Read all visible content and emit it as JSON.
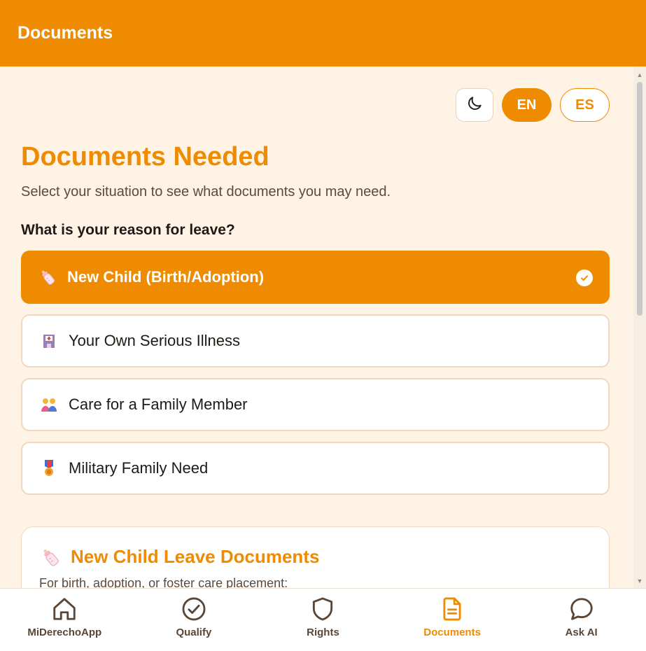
{
  "header": {
    "title": "Documents"
  },
  "toggles": {
    "theme_icon": "moon-icon",
    "lang_en": "EN",
    "lang_es": "ES"
  },
  "page": {
    "title": "Documents Needed",
    "subtitle": "Select your situation to see what documents you may need.",
    "question": "What is your reason for leave?"
  },
  "options": [
    {
      "label": "New Child (Birth/Adoption)",
      "icon": "baby-bottle-icon",
      "selected": true
    },
    {
      "label": "Your Own Serious Illness",
      "icon": "hospital-icon",
      "selected": false
    },
    {
      "label": "Care for a Family Member",
      "icon": "family-icon",
      "selected": false
    },
    {
      "label": "Military Family Need",
      "icon": "military-medal-icon",
      "selected": false
    }
  ],
  "card": {
    "title": "New Child Leave Documents",
    "icon": "baby-bottle-icon",
    "description": "For birth, adoption, or foster care placement:"
  },
  "nav": [
    {
      "label": "MiDerechoApp",
      "icon": "home-icon",
      "active": false
    },
    {
      "label": "Qualify",
      "icon": "check-circle-icon",
      "active": false
    },
    {
      "label": "Rights",
      "icon": "shield-icon",
      "active": false
    },
    {
      "label": "Documents",
      "icon": "document-icon",
      "active": true
    },
    {
      "label": "Ask AI",
      "icon": "chat-bubble-icon",
      "active": false
    }
  ],
  "colors": {
    "accent": "#EE8B00",
    "background": "#FFF3E6",
    "text": "#1f1a16"
  }
}
